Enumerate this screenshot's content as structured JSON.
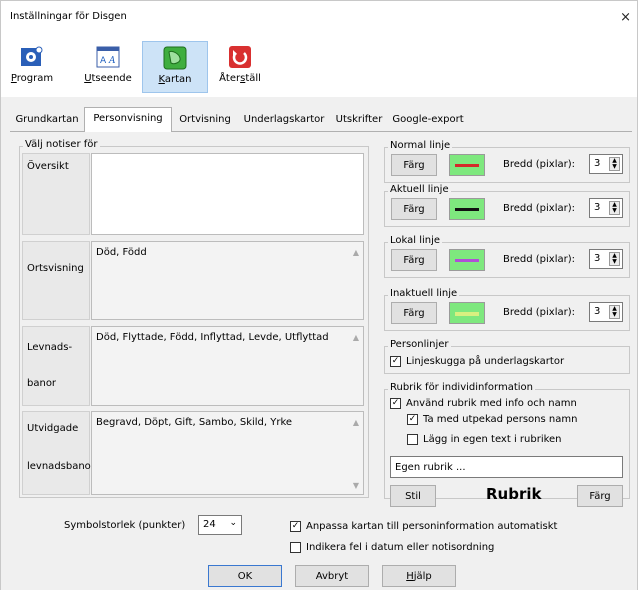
{
  "window": {
    "title": "Inställningar för Disgen",
    "close": "×"
  },
  "toolbar": {
    "items": [
      {
        "label": "Program",
        "accel": "P",
        "rest": "rogram"
      },
      {
        "label": "Utseende",
        "accel": "U",
        "rest": "tseende"
      },
      {
        "label": "Kartan",
        "accel": "K",
        "rest": "artan"
      },
      {
        "label": "Återställ",
        "pre": "Åter",
        "accel": "s",
        "rest": "täll"
      }
    ],
    "active": "Kartan"
  },
  "tabs": [
    "Grundkartan",
    "Personvisning",
    "Ortvisning",
    "Underlagskartor",
    "Utskrifter",
    "Google-export"
  ],
  "active_tab": "Personvisning",
  "notiser": {
    "title": "Välj notiser för",
    "rows": [
      {
        "label": "Översikt",
        "value": ""
      },
      {
        "label": "Ortsvisning",
        "value": "Död, Född"
      },
      {
        "label_line1": "Levnads-",
        "label_line2": "banor",
        "value": "Död, Flyttade, Född, Inflyttad, Levde, Utflyttad"
      },
      {
        "label_line1": "Utvidgade",
        "label_line2": "levnadsbano",
        "value": "Begravd, Döpt, Gift, Sambo, Skild, Yrke"
      }
    ]
  },
  "lines": {
    "color_button": "Färg",
    "width_label": "Bredd (pixlar):",
    "items": [
      {
        "title": "Normal linje",
        "color": "#d42a2a",
        "width": "3"
      },
      {
        "title": "Aktuell linje",
        "color": "#111111",
        "width": "3"
      },
      {
        "title": "Lokal linje",
        "color": "#b04fd6",
        "width": "3"
      },
      {
        "title": "Inaktuell linje",
        "color": "#d8f080",
        "width": "3"
      }
    ],
    "swatch_bg": "#7ee87e"
  },
  "personlinjer": {
    "title": "Personlinjer",
    "checkbox_label": "Linjeskugga på underlagskartor",
    "checked": true
  },
  "rubrik": {
    "title": "Rubrik för individinformation",
    "use_label": "Använd rubrik med info och namn",
    "use_checked": true,
    "name_label": "Ta med utpekad persons namn",
    "name_checked": true,
    "own_label": "Lägg in egen text i rubriken",
    "own_checked": false,
    "own_input": "Egen rubrik ...",
    "stil_button": "Stil",
    "preview": "Rubrik",
    "color_button": "Färg"
  },
  "symbol": {
    "label": "Symbolstorlek (punkter)",
    "value": "24"
  },
  "options": {
    "anpassa_label": "Anpassa kartan till personinformation automatiskt",
    "anpassa_checked": true,
    "indikera_label": "Indikera fel i datum eller notisordning",
    "indikera_checked": false
  },
  "buttons": {
    "ok": "OK",
    "cancel": "Avbryt",
    "help_accel": "H",
    "help_rest": "jälp"
  }
}
